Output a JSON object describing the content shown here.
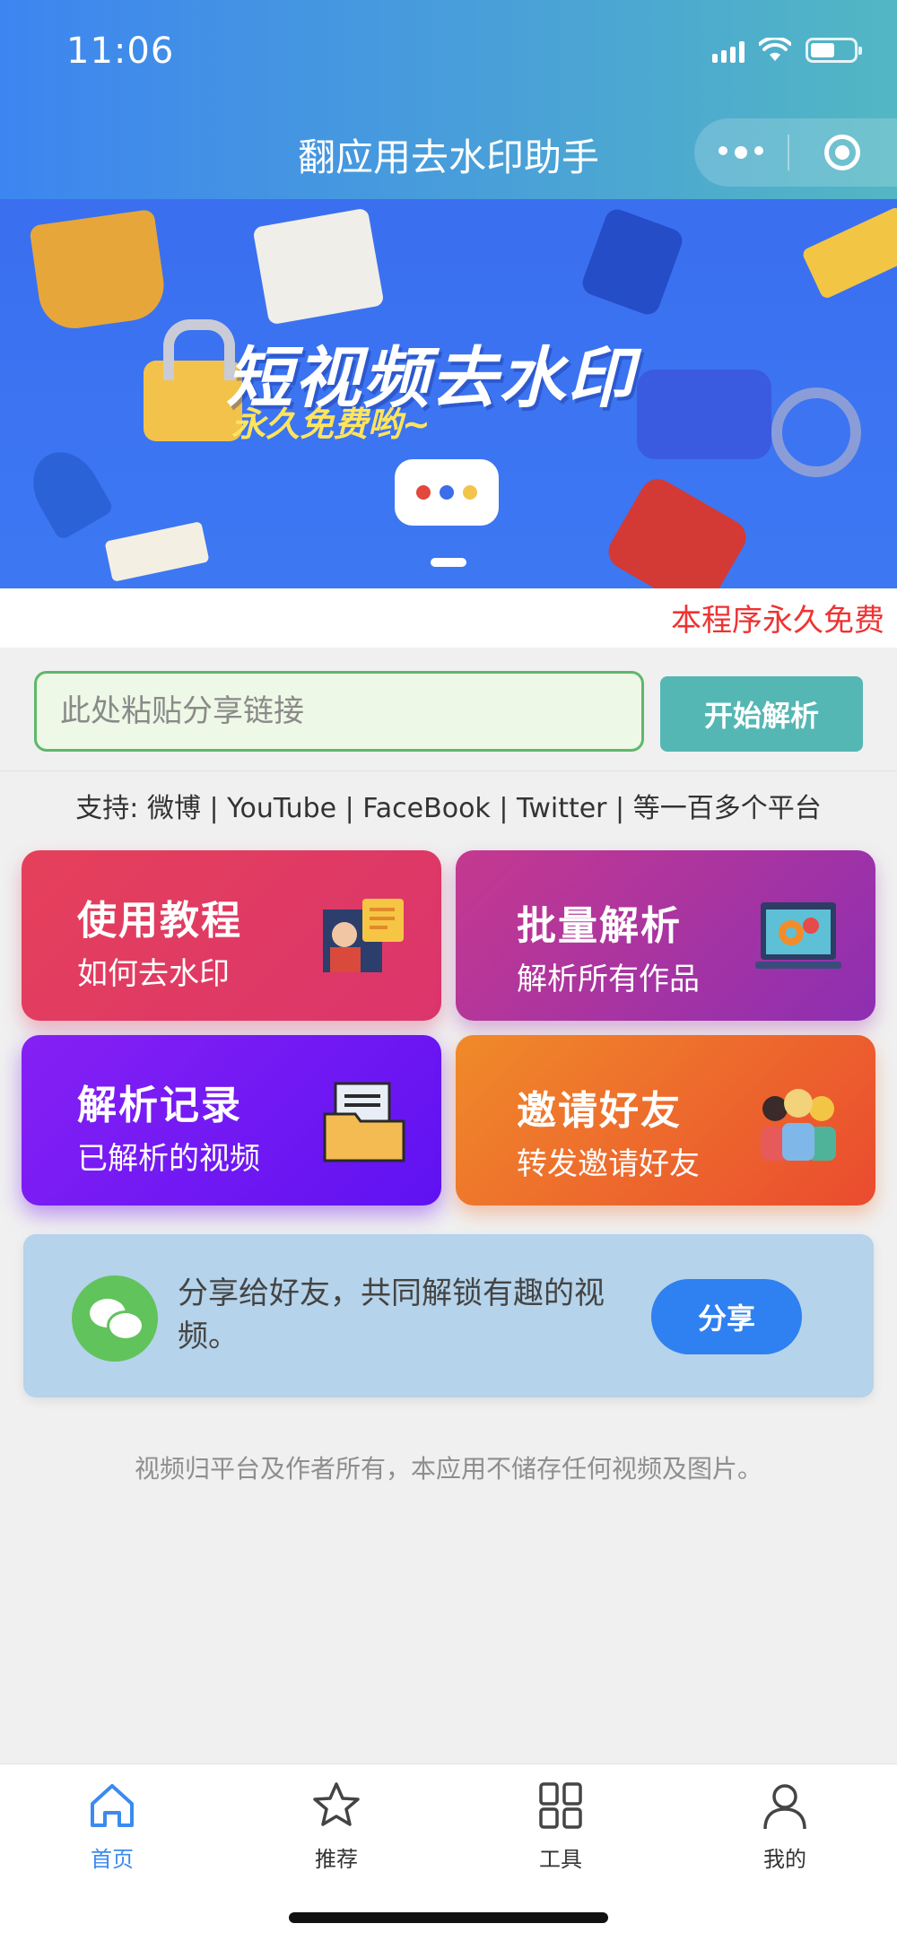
{
  "status_bar": {
    "time": "11:06"
  },
  "nav": {
    "title": "翻应用去水印助手"
  },
  "banner": {
    "title": "短视频去水印",
    "subtitle": "永久免费哟~"
  },
  "free_notice": "本程序永久免费",
  "search": {
    "placeholder": "此处粘贴分享链接",
    "value": "",
    "button_label": "开始解析"
  },
  "support_text": "支持: 微博 | YouTube | FaceBook | Twitter | 等一百多个平台",
  "cards": [
    {
      "title": "使用教程",
      "subtitle": "如何去水印"
    },
    {
      "title": "批量解析",
      "subtitle": "解析所有作品"
    },
    {
      "title": "解析记录",
      "subtitle": "已解析的视频"
    },
    {
      "title": "邀请好友",
      "subtitle": "转发邀请好友"
    }
  ],
  "share": {
    "text": "分享给好友，共同解锁有趣的视频。",
    "button_label": "分享"
  },
  "footer_note": "视频归平台及作者所有，本应用不储存任何视频及图片。",
  "tabbar": {
    "items": [
      {
        "label": "首页",
        "icon": "home-icon",
        "active": true
      },
      {
        "label": "推荐",
        "icon": "star-icon",
        "active": false
      },
      {
        "label": "工具",
        "icon": "grid-icon",
        "active": false
      },
      {
        "label": "我的",
        "icon": "user-icon",
        "active": false
      }
    ]
  },
  "colors": {
    "accent": "#3b8aef",
    "free_notice": "#e33333",
    "parse_button": "#55b7b4",
    "share_button": "#2f80f0"
  }
}
